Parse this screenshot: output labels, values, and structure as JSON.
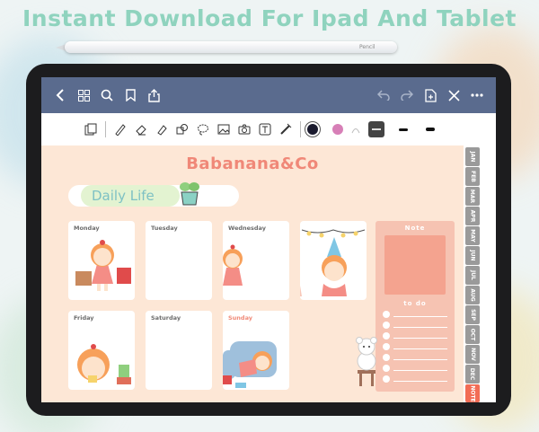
{
  "banner": {
    "headline": "Instant Download For Ipad And Tablet",
    "pencil_label": "Pencil"
  },
  "colors": {
    "headline": "#8fd3be",
    "topbar": "#5a6b8e",
    "page": "#fde7d6",
    "brand": "#f08878",
    "note_panel": "#f6c3b2",
    "note_box": "#f4a38f",
    "month_tab": "#9a9a9a",
    "note_tab": "#f26c55"
  },
  "topbar": {
    "icons": [
      "back-icon",
      "grid-icon",
      "search-icon",
      "bookmark-icon",
      "share-icon",
      "undo-icon",
      "redo-icon",
      "add-page-icon",
      "close-icon",
      "more-icon"
    ]
  },
  "toolbar": {
    "tools": [
      "page-view-icon",
      "pen-icon",
      "eraser-icon",
      "highlighter-icon",
      "shapes-icon",
      "lasso-icon",
      "image-icon",
      "camera-icon",
      "text-icon",
      "elements-icon"
    ],
    "swatches": [
      "#1a1a2e",
      "#d77fb7"
    ]
  },
  "planner": {
    "brand": "Babanana&Co",
    "section_title": "Daily Life",
    "days": [
      "Monday",
      "Tuesday",
      "Wednesday",
      "Friday",
      "Saturday",
      "Sunday"
    ],
    "note_label": "Note",
    "todo_label": "to do"
  },
  "months": [
    "JAN",
    "FEB",
    "MAR",
    "APR",
    "MAY",
    "JUN",
    "JUL",
    "AUG",
    "SEP",
    "OCT",
    "NOV",
    "DEC",
    "NOTE"
  ]
}
